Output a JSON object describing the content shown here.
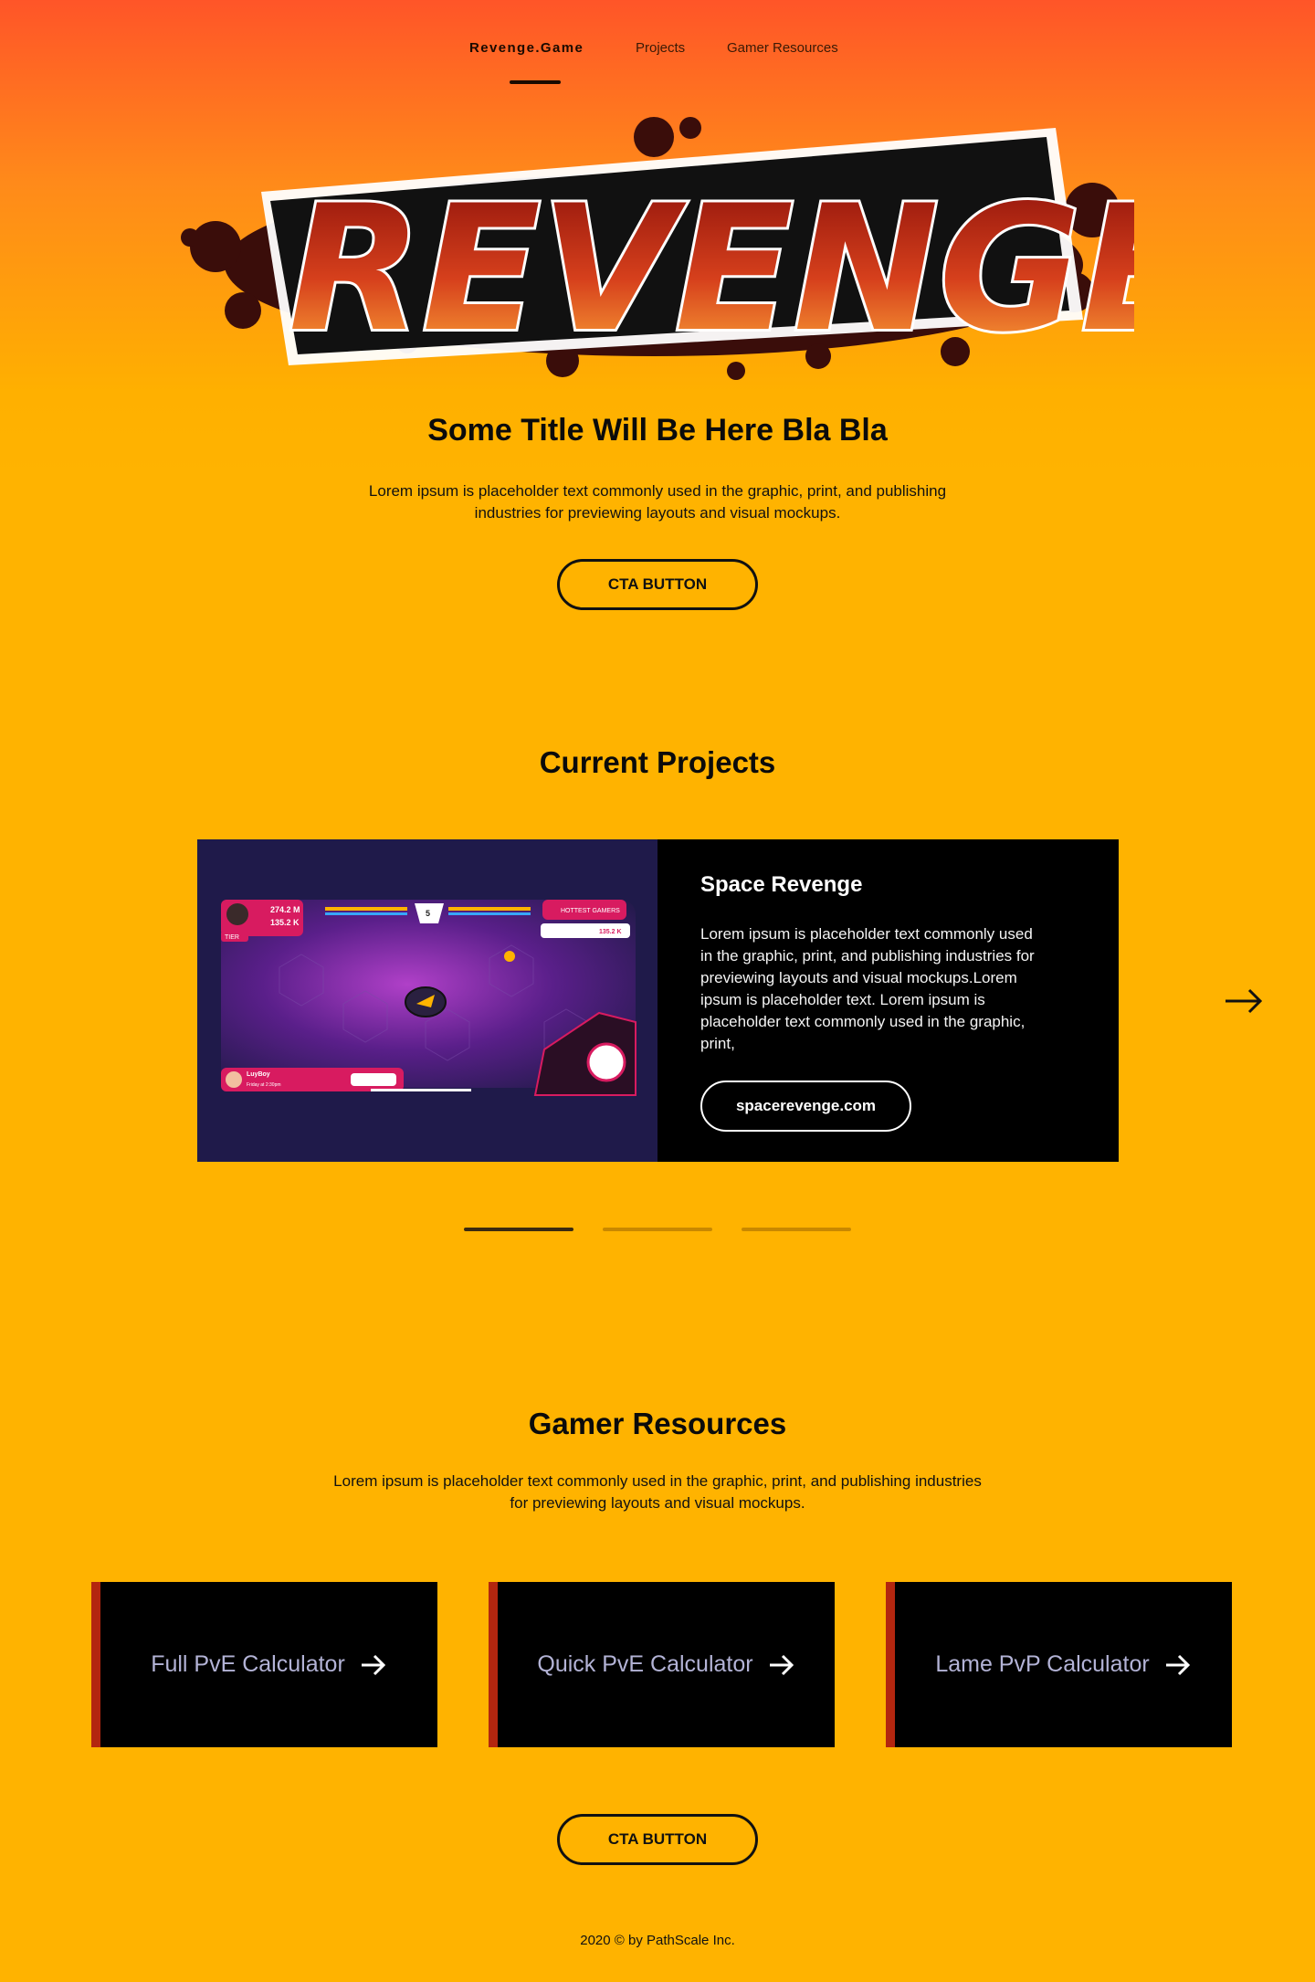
{
  "nav": {
    "brand": "Revenge.Game",
    "items": [
      "Projects",
      "Gamer Resources"
    ]
  },
  "logo": {
    "text": "REVENGE!"
  },
  "hero": {
    "title": "Some Title Will Be Here Bla Bla",
    "text": "Lorem ipsum is placeholder text commonly used in the graphic, print, and publishing industries for previewing layouts and visual mockups.",
    "cta": "CTA BUTTON"
  },
  "projects": {
    "title": "Current Projects",
    "current": {
      "name": "Space Revenge",
      "description": "Lorem ipsum is placeholder text commonly used in the graphic, print, and publishing industries for previewing layouts and visual mockups.Lorem ipsum is placeholder text. Lorem ipsum is placeholder text commonly used in the graphic, print,",
      "link": "spacerevenge.com",
      "screenshot": {
        "stat1": "274.2 M",
        "stat2": "135.2 K",
        "tier": "TIER",
        "center_number": "5",
        "hottest": "HOTTEST GAMERS",
        "rex": "135.2 K",
        "rex_label": "REX",
        "chat_user": "LuyBoy",
        "chat_time": "Friday at 2:30pm",
        "chat_msg": "Lorem ipsum dolor sit amet, consectetur adipiscing elit. Lorem"
      }
    },
    "slides": 3,
    "active_slide": 0
  },
  "resources": {
    "title": "Gamer Resources",
    "text": "Lorem ipsum is placeholder text commonly used in the graphic, print, and publishing industries for previewing layouts and visual mockups.",
    "tiles": [
      "Full PvE Calculator",
      "Quick PvE Calculator",
      "Lame PvP Calculator"
    ],
    "cta": "CTA BUTTON"
  },
  "footer": {
    "text": "2020 © by PathScale Inc."
  },
  "colors": {
    "accent": "#ffb300",
    "top_gradient": "#ff5528",
    "tile_stripe": "#b3260f",
    "tile_text": "#b3b3d6"
  }
}
